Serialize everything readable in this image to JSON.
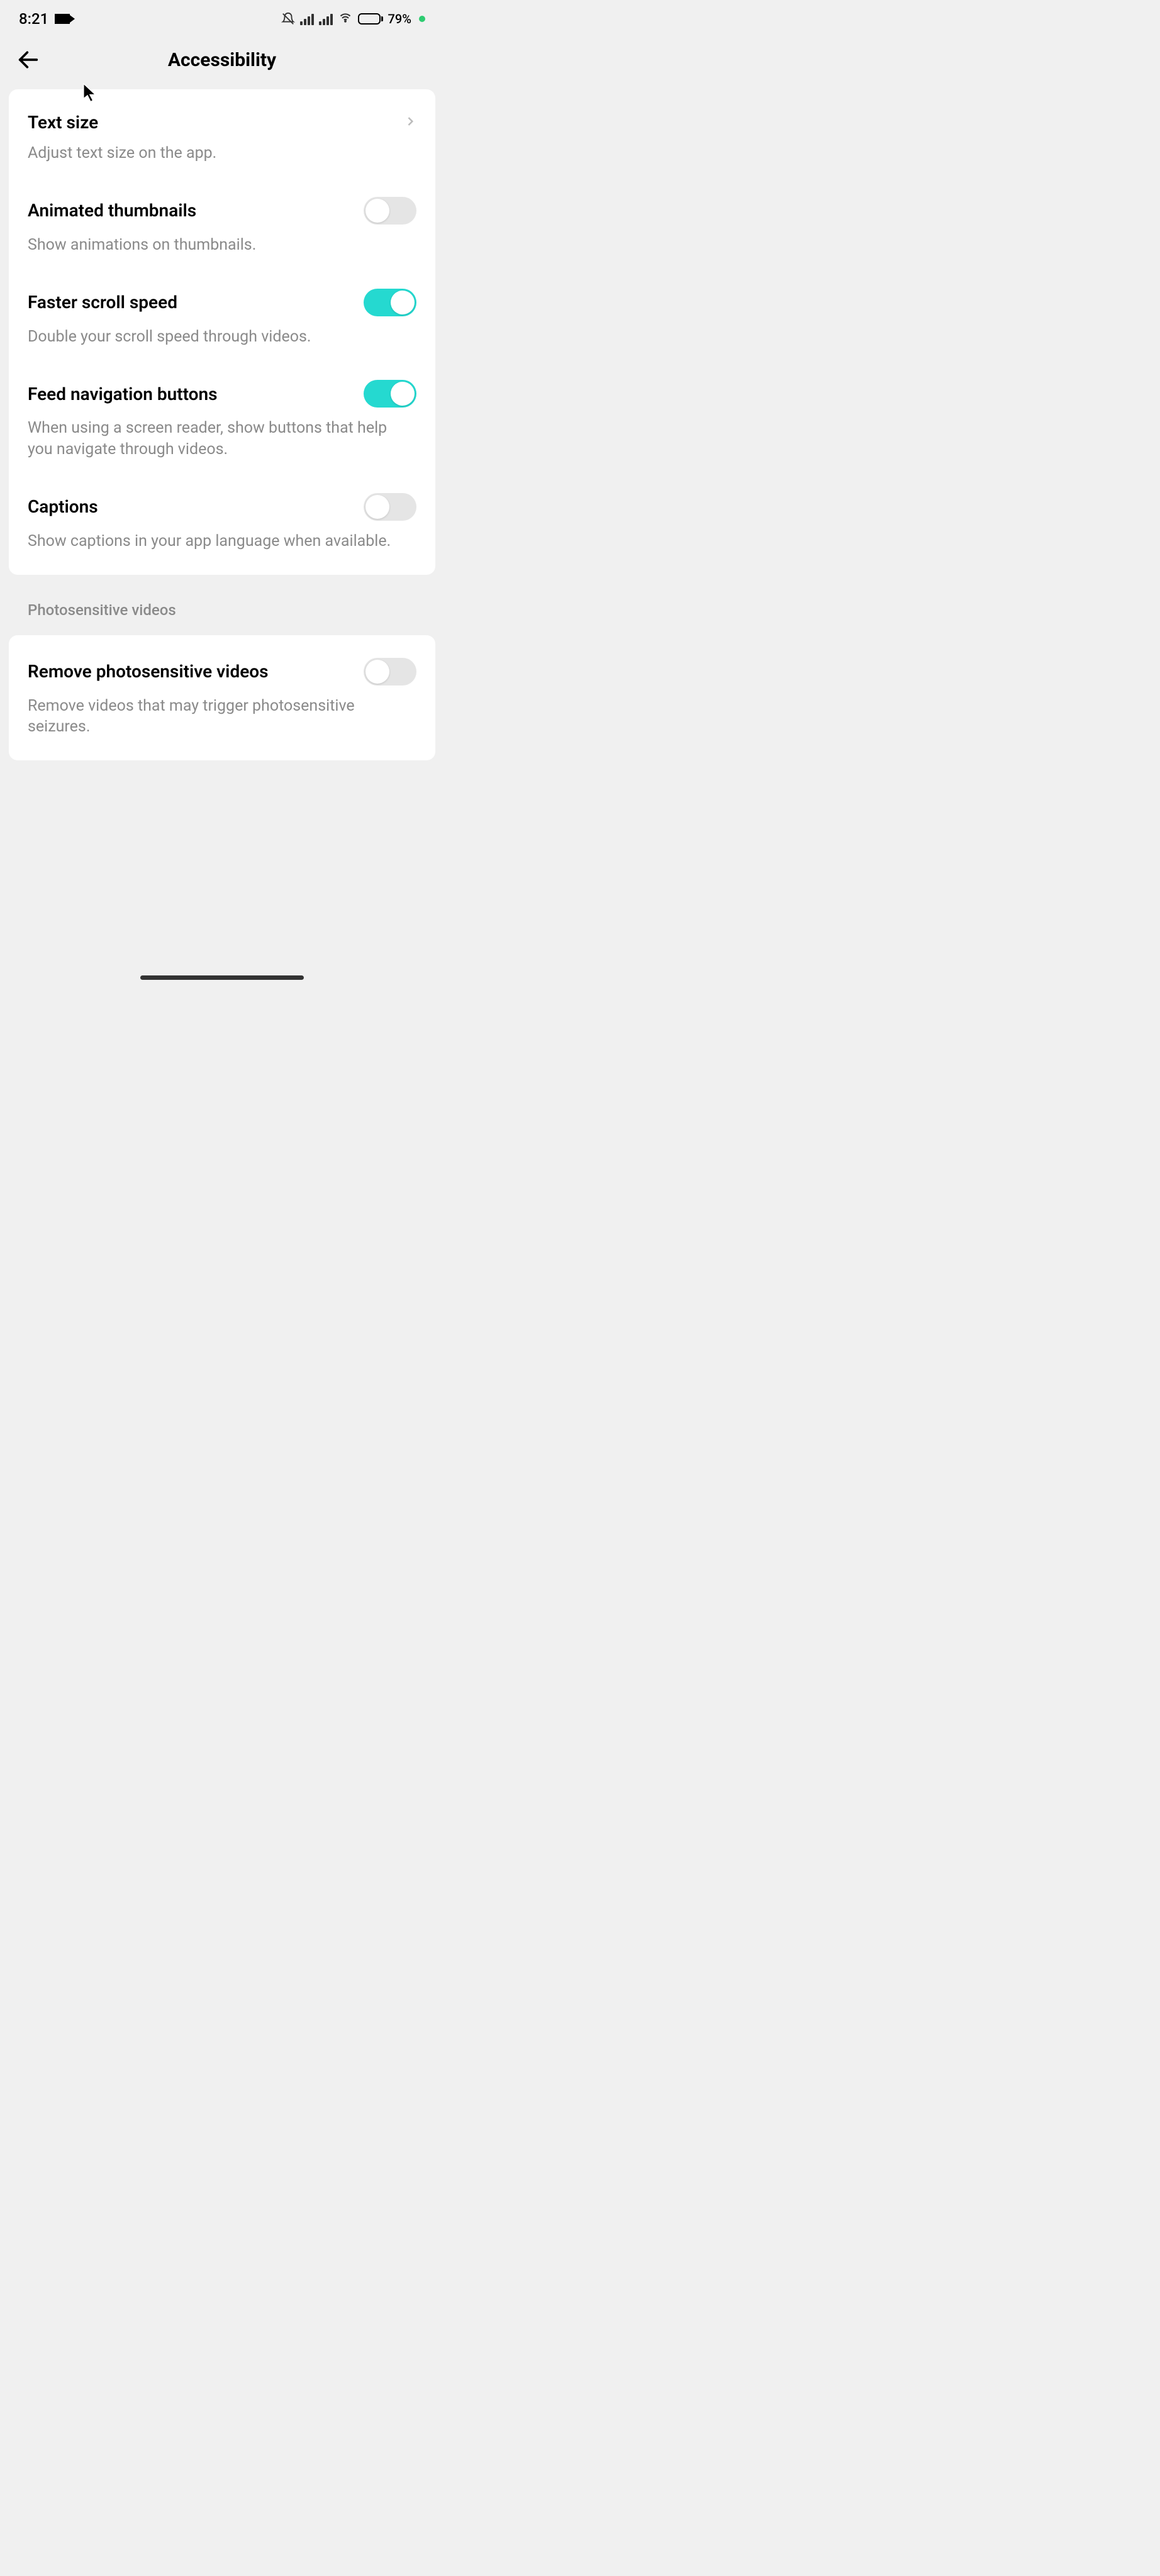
{
  "status_bar": {
    "time": "8:21",
    "battery_percent": "79%"
  },
  "header": {
    "title": "Accessibility"
  },
  "settings": {
    "text_size": {
      "title": "Text size",
      "desc": "Adjust text size on the app."
    },
    "animated_thumbnails": {
      "title": "Animated thumbnails",
      "desc": "Show animations on thumbnails.",
      "enabled": false
    },
    "faster_scroll": {
      "title": "Faster scroll speed",
      "desc": "Double your scroll speed through videos.",
      "enabled": true
    },
    "feed_nav": {
      "title": "Feed navigation buttons",
      "desc": "When using a screen reader, show buttons that help you navigate through videos.",
      "enabled": true
    },
    "captions": {
      "title": "Captions",
      "desc": "Show captions in your app language when available.",
      "enabled": false
    }
  },
  "section2": {
    "header": "Photosensitive videos",
    "remove_photosensitive": {
      "title": "Remove photosensitive videos",
      "desc": "Remove videos that may trigger photosensitive seizures.",
      "enabled": false
    }
  }
}
